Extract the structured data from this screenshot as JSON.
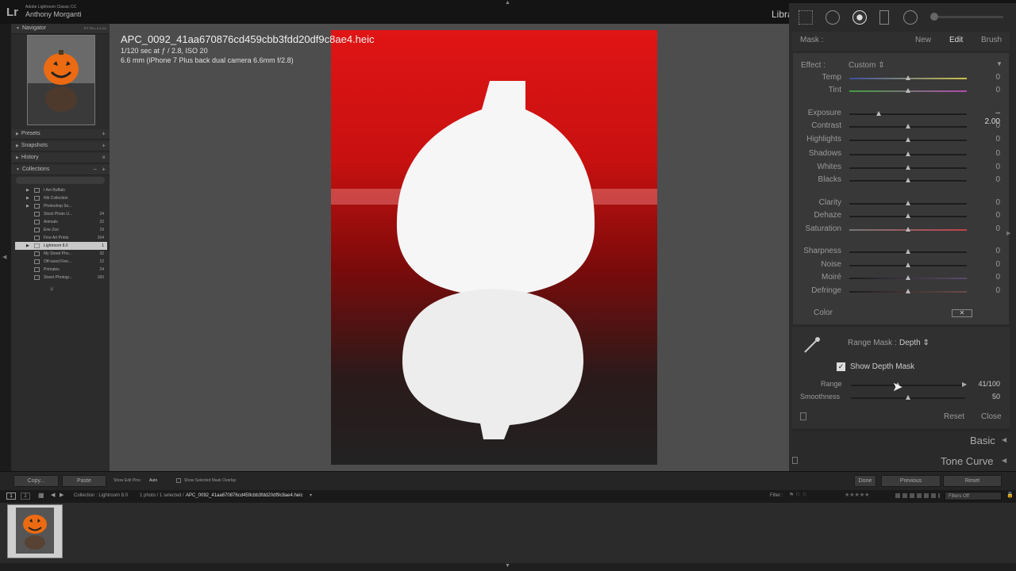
{
  "app": {
    "logo": "Lr",
    "name": "Adobe Lightroom Classic CC",
    "user": "Anthony Morganti",
    "module": "Libra"
  },
  "left": {
    "navigator": "Navigator",
    "nav_zoom": [
      "FIT",
      "FILL",
      "1:1",
      "4:1"
    ],
    "presets": "Presets",
    "snapshots": "Snapshots",
    "history": "History",
    "collections": "Collections",
    "items": [
      {
        "name": "I Am Buffalo",
        "count": ""
      },
      {
        "name": "Nik Collection",
        "count": ""
      },
      {
        "name": "Photoshop Se...",
        "count": ""
      },
      {
        "name": "Stock Photo U...",
        "count": "24"
      },
      {
        "name": "Animals",
        "count": "22"
      },
      {
        "name": "Erie Zoo",
        "count": "19"
      },
      {
        "name": "Fine Art Prints",
        "count": "164"
      },
      {
        "name": "Lightroom 8.0",
        "count": "1"
      },
      {
        "name": "My Street Pho...",
        "count": "32"
      },
      {
        "name": "Off-sized Fine...",
        "count": "12"
      },
      {
        "name": "Primates",
        "count": "24"
      },
      {
        "name": "Street Photogr...",
        "count": "160"
      }
    ]
  },
  "photo": {
    "filename": "APC_0092_41aa670876cd459cbb3fdd20df9c8ae4.heic",
    "exposure": "1/120 sec at ƒ / 2.8, ISO 20",
    "lens": "6.6 mm (iPhone 7 Plus back dual camera 6.6mm f/2.8)"
  },
  "right": {
    "mask_label": "Mask :",
    "mask_new": "New",
    "mask_edit": "Edit",
    "mask_brush": "Brush",
    "effect_label": "Effect :",
    "effect_value": "Custom",
    "sliders": [
      {
        "label": "Temp",
        "value": "0",
        "pos": 0.5
      },
      {
        "label": "Tint",
        "value": "0",
        "pos": 0.5
      },
      {
        "label": "Exposure",
        "value": "– 2.00",
        "pos": 0.25
      },
      {
        "label": "Contrast",
        "value": "0",
        "pos": 0.5
      },
      {
        "label": "Highlights",
        "value": "0",
        "pos": 0.5
      },
      {
        "label": "Shadows",
        "value": "0",
        "pos": 0.5
      },
      {
        "label": "Whites",
        "value": "0",
        "pos": 0.5
      },
      {
        "label": "Blacks",
        "value": "0",
        "pos": 0.5
      },
      {
        "label": "Clarity",
        "value": "0",
        "pos": 0.5
      },
      {
        "label": "Dehaze",
        "value": "0",
        "pos": 0.5
      },
      {
        "label": "Saturation",
        "value": "0",
        "pos": 0.5
      },
      {
        "label": "Sharpness",
        "value": "0",
        "pos": 0.5
      },
      {
        "label": "Noise",
        "value": "0",
        "pos": 0.5
      },
      {
        "label": "Moiré",
        "value": "0",
        "pos": 0.5
      },
      {
        "label": "Defringe",
        "value": "0",
        "pos": 0.5
      }
    ],
    "color_label": "Color",
    "range_mask_label": "Range Mask :",
    "range_mask_value": "Depth",
    "show_depth_mask": "Show Depth Mask",
    "range_label": "Range",
    "range_value": "41/100",
    "range_pos": 0.41,
    "smoothness_label": "Smoothness",
    "smoothness_value": "50",
    "smoothness_pos": 0.5,
    "reset": "Reset",
    "close": "Close",
    "basic": "Basic",
    "tone_curve": "Tone Curve"
  },
  "toolbar": {
    "copy": "Copy...",
    "paste": "Paste",
    "show_edit_pins": "Show Edit Pins :",
    "edit_pins_value": "Auto",
    "show_mask_overlay": "Show Selected Mask Overlay",
    "done": "Done",
    "previous": "Previous",
    "reset": "Reset"
  },
  "filmbar": {
    "collection": "Collection : Lightroom 8.0",
    "selection": "1 photo / 1 selected /",
    "file": "APC_0092_41aa670876cd459cbb3fdd20df9c8ae4.heic",
    "filter": "Filter :",
    "filters_off": "Filters Off",
    "views": [
      "1",
      "2"
    ]
  }
}
